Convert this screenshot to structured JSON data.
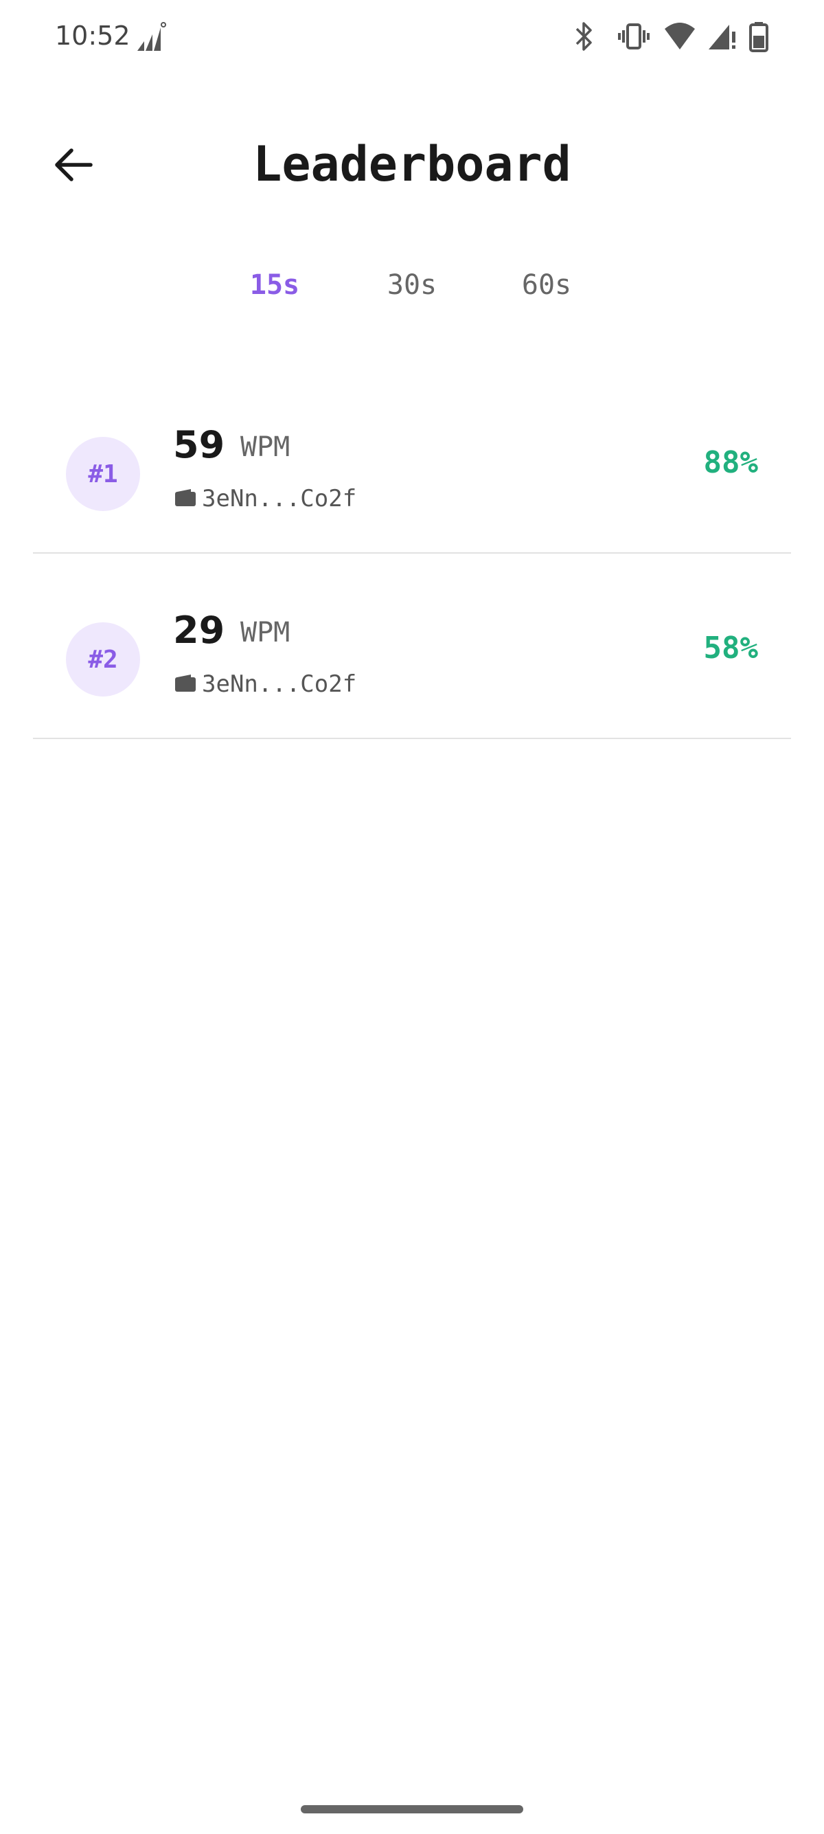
{
  "status_bar": {
    "time": "10:52",
    "icons": [
      "signal-activity-icon",
      "bluetooth-icon",
      "vibrate-icon",
      "wifi-icon",
      "cell-signal-icon",
      "battery-icon"
    ]
  },
  "header": {
    "back_icon": "arrow-left-icon",
    "title": "Leaderboard"
  },
  "tabs": [
    {
      "label": "15s",
      "active": true
    },
    {
      "label": "30s",
      "active": false
    },
    {
      "label": "60s",
      "active": false
    }
  ],
  "leaderboard": [
    {
      "rank": "#1",
      "wpm": "59",
      "unit": "WPM",
      "wallet_icon": "wallet-icon",
      "address": "3eNn...Co2f",
      "accuracy": "88%"
    },
    {
      "rank": "#2",
      "wpm": "29",
      "unit": "WPM",
      "wallet_icon": "wallet-icon",
      "address": "3eNn...Co2f",
      "accuracy": "58%"
    }
  ],
  "colors": {
    "accent": "#8a5ce6",
    "badge_bg": "#efe8fd",
    "accuracy": "#21b07e",
    "divider": "#e2e2e2"
  }
}
